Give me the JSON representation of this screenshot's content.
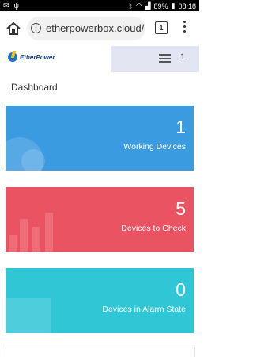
{
  "status": {
    "battery": "89%",
    "time": "08:18"
  },
  "browser": {
    "url": "etherpowerbox.cloud/d",
    "tab_count": "1"
  },
  "app": {
    "brand": "EtherPower",
    "header_count": "1"
  },
  "page": {
    "title": "Dashboard"
  },
  "cards": [
    {
      "value": "1",
      "label": "Working Devices",
      "color": "#3a9be1"
    },
    {
      "value": "5",
      "label": "Devices to Check",
      "color": "#ea5462"
    },
    {
      "value": "0",
      "label": "Devices in Alarm State",
      "color": "#2fc6d6"
    }
  ]
}
